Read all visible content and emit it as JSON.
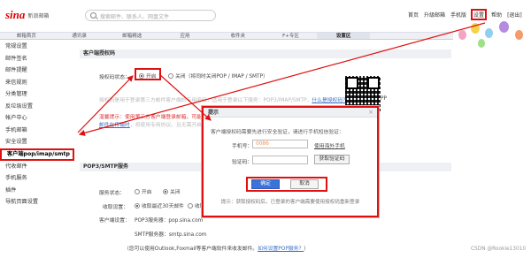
{
  "header": {
    "logo_mark": "sina",
    "logo_text": "新浪邮箱",
    "search_placeholder": "搜索邮件、联系人、网盘文件",
    "links": [
      "首页",
      "升级邮箱",
      "手机版",
      "设置",
      "帮助",
      "[退出]"
    ]
  },
  "nav_tabs": [
    "邮箱首页",
    "通讯录",
    "邮箱精选",
    "应用",
    "收件夹",
    "F+专区",
    "设置区"
  ],
  "sidebar": {
    "items": [
      "常规设置",
      "邮件签名",
      "邮件提醒",
      "来信规则",
      "分类管理",
      "反垃圾设置",
      "帐户中心",
      "手机邮箱",
      "安全设置",
      "客户端pop/imap/smtp",
      "代收邮件",
      "手机服务",
      "插件",
      "导航页面设置"
    ]
  },
  "client_section": {
    "title": "客户端授权码",
    "status_label": "授权码状态：",
    "opt_on": "开启",
    "opt_off": "关闭（将同时关闭POP / IMAP / SMTP）",
    "desc": "授权码是用于登录第三方邮件客户端的专用密码，适用于登录以下服务：POP3/IMAP/SMTP。",
    "desc_link": "什么是授权码？如何使用？",
    "warn": "温馨提示：使用第三方客户端登录邮箱，可能无法使用安全登录，",
    "warn_link": "邮件在传输时",
    "warn2": "，将使用专用协议。且无需开启pop3/imap/smtp服务"
  },
  "pop_section": {
    "title": "POP3/SMTP服务",
    "status_label": "服务状态：",
    "opt_on": "开启",
    "opt_off": "关闭",
    "receive_label": "收取设置：",
    "receive_value": "收取最近30天邮件",
    "receive_all": "收取全部",
    "client_label": "客户端设置：",
    "pop_server": "POP3服务器：pop.sina.com",
    "smtp_server": "SMTP服务器：smtp.sina.com",
    "hint": "（您可以使用Outlook,Foxmail等客户端软件来收发邮件。",
    "hint_link": "如何设置POP服务？",
    "hint_end": "）"
  },
  "side_app_text": "APP",
  "modal": {
    "title": "提示",
    "close": "×",
    "desc": "客户端授权码需要先进行安全验证，请进行手机短信验证：",
    "phone_label": "手机号：",
    "phone_value": "0086",
    "phone_link": "使用海外手机",
    "code_label": "验证码：",
    "get_code": "获取验证码",
    "ok": "确定",
    "cancel": "取消",
    "tip": "提示：获取授权码后，已登录的客户端需要使用授权码重新登录"
  },
  "footer_text": "CSDN @Rookie13010",
  "colors": {
    "annotation_red": "#e01010",
    "primary_blue": "#3a74d8",
    "link_blue": "#3a6fc4"
  }
}
